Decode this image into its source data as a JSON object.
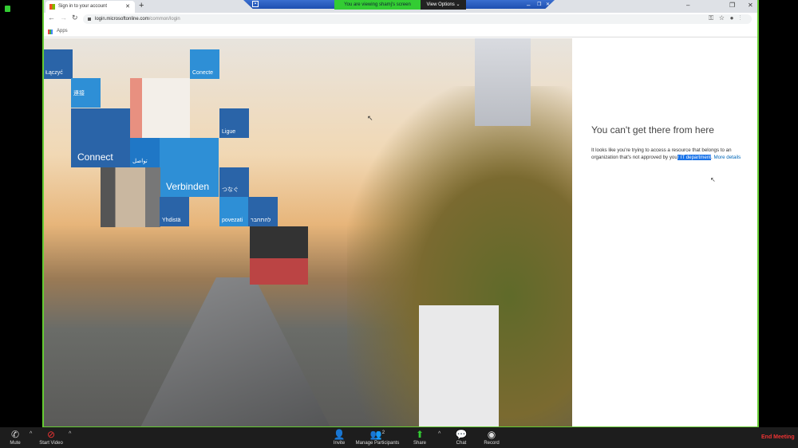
{
  "browser": {
    "tab_title": "Sign in to your account",
    "url_host": "login.microsoftonline.com",
    "url_path": "/common/login",
    "bookmarks_label": "Apps"
  },
  "zoom_banner": {
    "viewing": "You are viewing shamj's screen",
    "view_options": "View Options"
  },
  "tiles": {
    "laczyc": "Łączyć",
    "conecte": "Conecte",
    "lianjie": "連接",
    "connect": "Connect",
    "ligue": "Ligue",
    "arabic": "تواصل",
    "verbinden": "Verbinden",
    "tsunagu": "つなぐ",
    "yhdista": "Yhdistä",
    "povezati": "povezati",
    "hebrew": "להתחבר"
  },
  "error": {
    "title": "You can't get there from here",
    "body_pre": "It looks like you're trying to access a resource that belongs to an organization that's not approved by you",
    "body_hl": "r IT department",
    "body_post": ". ",
    "more_details": "More details"
  },
  "toolbar": {
    "mute": "Mute",
    "start_video": "Start Video",
    "invite": "Invite",
    "manage_participants": "Manage Participants",
    "participant_count": "2",
    "share": "Share",
    "chat": "Chat",
    "record": "Record",
    "end_meeting": "End Meeting"
  },
  "colors": {
    "zoom_green": "#66cc33",
    "tile_dark": "#2a64a8",
    "tile_light": "#2e8fd6",
    "end_red": "#ee3333"
  }
}
